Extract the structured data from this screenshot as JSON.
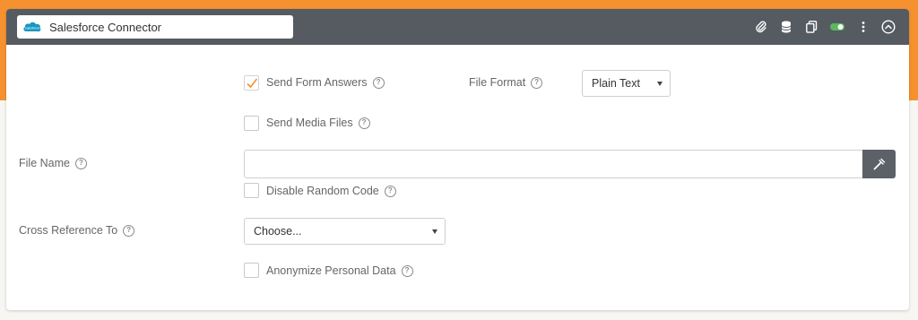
{
  "header": {
    "title": "Salesforce Connector",
    "logo_text": "salesforce",
    "icons": [
      "paperclip-icon",
      "database-icon",
      "copy-icon",
      "toggle-icon",
      "more-vertical-icon",
      "collapse-icon"
    ]
  },
  "form": {
    "send_form_answers": {
      "label": "Send Form Answers",
      "checked": true
    },
    "file_format": {
      "label": "File Format",
      "selected": "Plain Text"
    },
    "send_media_files": {
      "label": "Send Media Files",
      "checked": false
    },
    "file_name": {
      "label": "File Name",
      "value": "",
      "placeholder": ""
    },
    "disable_random_code": {
      "label": "Disable Random Code",
      "checked": false
    },
    "cross_reference": {
      "label": "Cross Reference To",
      "selected": "Choose..."
    },
    "anonymize": {
      "label": "Anonymize Personal Data",
      "checked": false
    }
  },
  "help_glyph": "?",
  "colors": {
    "accent": "#f5922f",
    "header": "#555b61",
    "toggle": "#5cb85c",
    "salesforce": "#1798c1"
  }
}
